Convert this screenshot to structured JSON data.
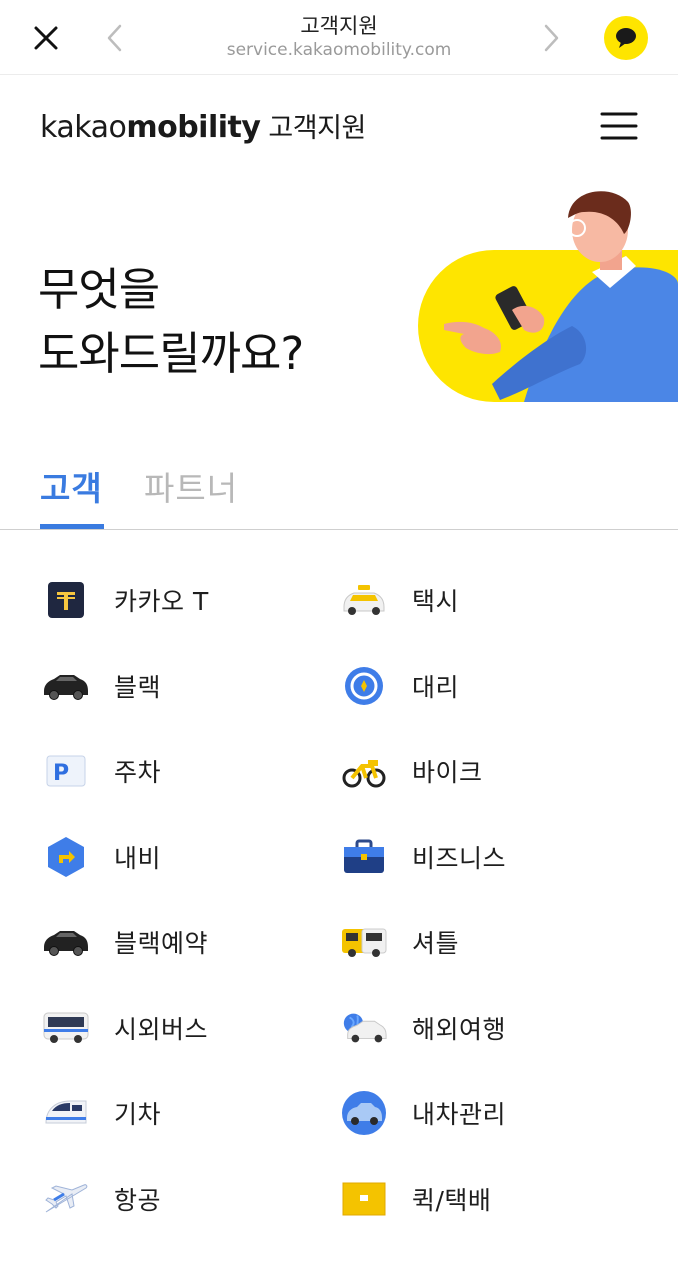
{
  "browser": {
    "title": "고객지원",
    "url": "service.kakaomobility.com",
    "icons": [
      "close-icon",
      "back-arrow-icon",
      "forward-arrow-icon",
      "kakaotalk-chat-icon"
    ]
  },
  "header": {
    "brand_part1": "kakao",
    "brand_part2": "mobility",
    "brand_part3": "고객지원",
    "menu_icon": "hamburger-menu-icon"
  },
  "hero": {
    "line1": "무엇을",
    "line2": "도와드릴까요?"
  },
  "tabs": [
    {
      "label": "고객",
      "active": true
    },
    {
      "label": "파트너",
      "active": false
    }
  ],
  "colors": {
    "accent": "#3a7be0",
    "kakao_yellow": "#FEE500"
  },
  "services": [
    {
      "label": "카카오 T",
      "icon": "kakao-t-icon"
    },
    {
      "label": "택시",
      "icon": "taxi-icon"
    },
    {
      "label": "블랙",
      "icon": "black-car-icon"
    },
    {
      "label": "대리",
      "icon": "steering-wheel-icon"
    },
    {
      "label": "주차",
      "icon": "parking-icon"
    },
    {
      "label": "바이크",
      "icon": "bike-icon"
    },
    {
      "label": "내비",
      "icon": "navi-icon"
    },
    {
      "label": "비즈니스",
      "icon": "briefcase-icon"
    },
    {
      "label": "블랙예약",
      "icon": "black-reservation-icon"
    },
    {
      "label": "셔틀",
      "icon": "shuttle-bus-icon"
    },
    {
      "label": "시외버스",
      "icon": "intercity-bus-icon"
    },
    {
      "label": "해외여행",
      "icon": "overseas-travel-icon"
    },
    {
      "label": "기차",
      "icon": "train-icon"
    },
    {
      "label": "내차관리",
      "icon": "car-care-icon"
    },
    {
      "label": "항공",
      "icon": "airplane-icon"
    },
    {
      "label": "퀵/택배",
      "icon": "delivery-box-icon"
    }
  ]
}
